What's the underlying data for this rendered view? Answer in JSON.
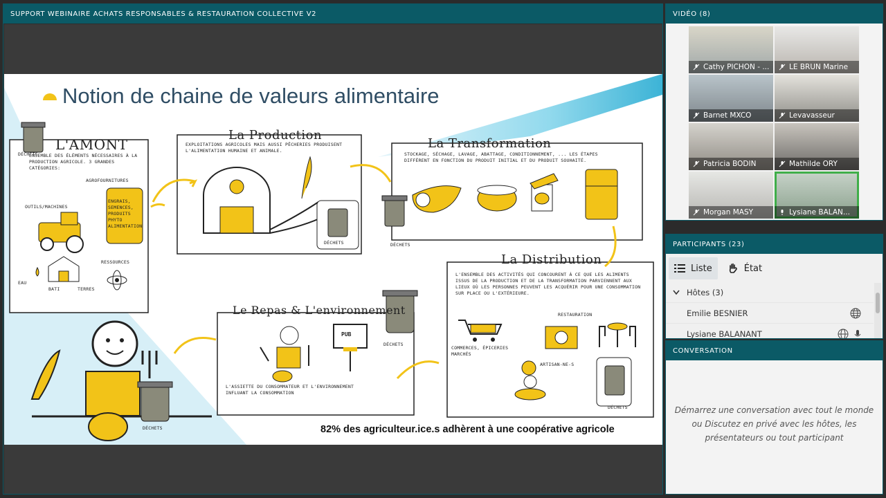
{
  "share_pod": {
    "title": "SUPPORT WEBINAIRE ACHATS RESPONSABLES & RESTAURATION COLLECTIVE V2"
  },
  "slide": {
    "title": "Notion de chaine de valeurs alimentaire",
    "amont": {
      "heading": "L'AMONT",
      "dechets": "DÉCHETS",
      "desc": "ENSEMBLE DES ÉLÉMENTS NÉCESSAIRES À LA PRODUCTION AGRICOLE. 3 GRANDES CATÉGORIES:",
      "agro": "AGROFOURNITURES",
      "bag_text": "ENGRAIS, SEMENCES, PRODUITS PHYTO ALIMENTATION",
      "outils": "OUTILS/MACHINES",
      "ressources": "RESSOURCES",
      "eau": "EAU",
      "bati": "BATI",
      "terres": "TERRES"
    },
    "production": {
      "heading": "La Production",
      "desc": "EXPLOITATIONS AGRICOLES MAIS AUSSI PÊCHERIES PRODUISENT L'ALIMENTATION HUMAINE ET ANIMALE.",
      "dechets": "DÉCHETS"
    },
    "transformation": {
      "heading": "La Transformation",
      "desc": "STOCKAGE, SÉCHAGE, LAVAGE, ABATTAGE, CONDITIONNEMENT, ... LES ÉTAPES DIFFÈRENT EN FONCTION DU PRODUIT INITIAL ET DU PRODUIT SOUHAITÉ.",
      "dechets": "DÉCHETS"
    },
    "distribution": {
      "heading": "La Distribution",
      "desc": "L'ENSEMBLE DES ACTIVITÉS QUI CONCOURENT À CE QUE LES ALIMENTS ISSUS DE LA PRODUCTION ET DE LA TRANSFORMATION PARVIENNENT AUX LIEUX OÙ LES PERSONNES PEUVENT LES ACQUÉRIR POUR UNE CONSOMMATION SUR PLACE OU L'EXTÉRIEURE.",
      "restauration": "RESTAURATION",
      "commerces": "COMMERCES, ÉPICERIES MARCHÉS",
      "artisans": "ARTISAN-NE-S",
      "dechets": "DÉCHETS"
    },
    "repas": {
      "heading": "Le Repas & L'environnement",
      "pub": "PUB",
      "desc": "L'ASSIETTE DU CONSOMMATEUR ET L'ENVIRONNEMENT INFLUANT LA CONSOMMATION",
      "dechets": "DÉCHETS"
    },
    "consumer_dechets": "DÉCHETS",
    "footer": "82% des agriculteur.ice.s adhèrent à une coopérative agricole"
  },
  "video_pod": {
    "title": "VIDÉO (8)",
    "tiles": [
      {
        "name": "Cathy PICHON - ..."
      },
      {
        "name": "LE BRUN Marine"
      },
      {
        "name": "Barnet MXCO"
      },
      {
        "name": "Levavasseur"
      },
      {
        "name": "Patricia BODIN"
      },
      {
        "name": "Mathilde ORY"
      },
      {
        "name": "Morgan MASY"
      },
      {
        "name": "Lysiane BALAN..."
      }
    ]
  },
  "participants_pod": {
    "title": "PARTICIPANTS (23)",
    "view_list": "Liste",
    "view_status": "État",
    "group_hosts": "Hôtes (3)",
    "people": [
      {
        "name": "Emilie BESNIER"
      },
      {
        "name": "Lysiane BALANANT"
      }
    ]
  },
  "chat_pod": {
    "title": "CONVERSATION",
    "empty_text": "Démarrez une conversation avec tout le monde ou Discutez en privé avec les hôtes, les présentateurs ou tout participant"
  },
  "colors": {
    "pod_header": "#0b5a66",
    "accent_yellow": "#f2c318",
    "slide_cyan": "#bfe6f2",
    "active_speaker": "#3fae49"
  }
}
